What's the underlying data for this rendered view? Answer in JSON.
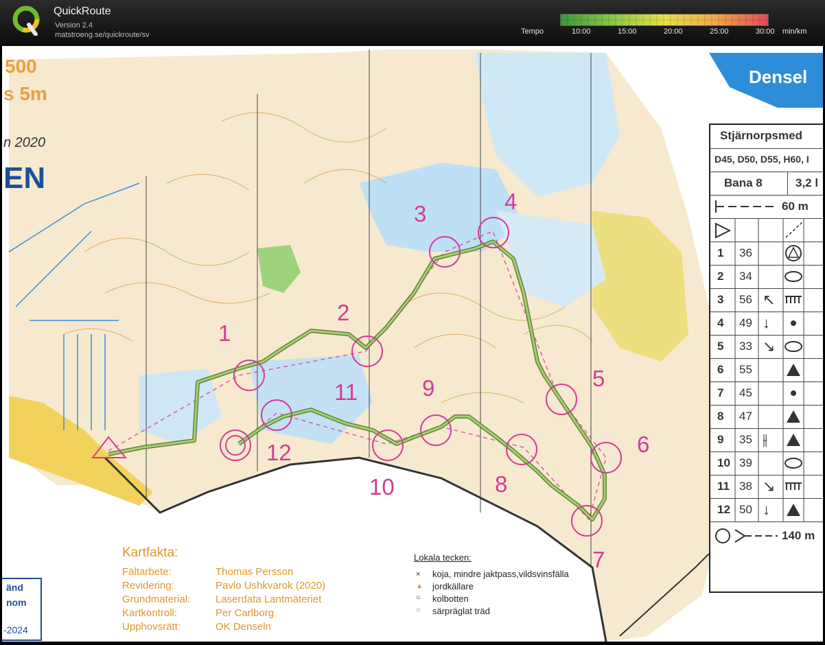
{
  "app": {
    "title": "QuickRoute",
    "version": "Version 2.4",
    "url": "matstroeng.se/quickroute/sv"
  },
  "tempo": {
    "label": "Tempo",
    "ticks": [
      "10:00",
      "15:00",
      "20:00",
      "25:00",
      "30:00"
    ],
    "unit": "min/km",
    "colors": [
      "#2e9f2e",
      "#8ccb40",
      "#e8e43a",
      "#f0a040",
      "#e84050"
    ]
  },
  "map": {
    "scale_partial": "500",
    "equidistance_partial": "s 5m",
    "year_partial": "n 2020",
    "name_partial": "EN",
    "club_partial": "Densel"
  },
  "course_card": {
    "event": "Stjärnorpsmed",
    "classes": "D45, D50, D55, H60, I",
    "course": "Bana 8",
    "length": "3,2 l",
    "start_dist": "60 m",
    "finish_dist": "140 m",
    "controls": [
      {
        "num": "1",
        "code": "36"
      },
      {
        "num": "2",
        "code": "34"
      },
      {
        "num": "3",
        "code": "56"
      },
      {
        "num": "4",
        "code": "49"
      },
      {
        "num": "5",
        "code": "33"
      },
      {
        "num": "6",
        "code": "55"
      },
      {
        "num": "7",
        "code": "45"
      },
      {
        "num": "8",
        "code": "47"
      },
      {
        "num": "9",
        "code": "35"
      },
      {
        "num": "10",
        "code": "39"
      },
      {
        "num": "11",
        "code": "38"
      },
      {
        "num": "12",
        "code": "50"
      }
    ]
  },
  "control_labels": [
    "1",
    "2",
    "3",
    "4",
    "5",
    "6",
    "7",
    "8",
    "9",
    "10",
    "11",
    "12"
  ],
  "kartfakta": {
    "heading": "Kartfakta:",
    "rows": [
      {
        "k": "Fältarbete:",
        "v": "Thomas Persson"
      },
      {
        "k": "Revidering:",
        "v": "Pavlo Ushkvarok (2020)"
      },
      {
        "k": "Grundmaterial:",
        "v": "Laserdata Lantmäteriet"
      },
      {
        "k": "Kartkontroll:",
        "v": "Per Carlborg"
      },
      {
        "k": "Upphovsrätt:",
        "v": "OK Denseln"
      }
    ]
  },
  "lokala": {
    "heading": "Lokala tecken:",
    "items": [
      "koja, mindre jaktpass,vildsvinsfälla",
      "jordkällare",
      "kolbotten",
      "särpräglat träd"
    ]
  },
  "corner_box": [
    "änd",
    "nom",
    "-2024"
  ]
}
